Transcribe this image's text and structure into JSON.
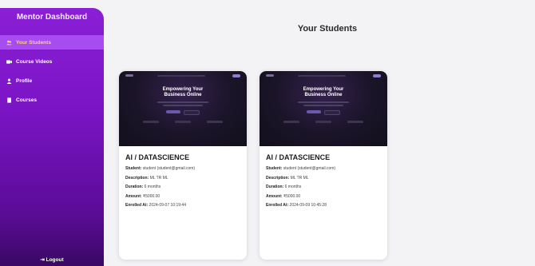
{
  "sidebar": {
    "title": "Mentor Dashboard",
    "items": [
      {
        "label": "Your Students",
        "icon": "users-icon",
        "active": true
      },
      {
        "label": "Course Videos",
        "icon": "video-icon",
        "active": false
      },
      {
        "label": "Profile",
        "icon": "person-icon",
        "active": false
      },
      {
        "label": "Courses",
        "icon": "book-icon",
        "active": false
      }
    ],
    "logout_label": "Logout"
  },
  "main": {
    "title": "Your Students"
  },
  "cards": [
    {
      "thumb_heading_line1": "Empowering Your",
      "thumb_heading_line2": "Business Online",
      "course": "AI / DATASCIENCE",
      "student_label": "Student:",
      "student": "student (student@gmail.com)",
      "description_label": "Description:",
      "description": "ML TR ML",
      "duration_label": "Duration:",
      "duration": "6 months",
      "amount_label": "Amount:",
      "amount": "₹5000.00",
      "enrolled_label": "Enrolled At:",
      "enrolled": "2024-09-07 10:19:44"
    },
    {
      "thumb_heading_line1": "Empowering Your",
      "thumb_heading_line2": "Business Online",
      "course": "AI / DATASCIENCE",
      "student_label": "Student:",
      "student": "student (student@gmail.com)",
      "description_label": "Description:",
      "description": "ML TR ML",
      "duration_label": "Duration:",
      "duration": "6 months",
      "amount_label": "Amount:",
      "amount": "₹5000.00",
      "enrolled_label": "Enrolled At:",
      "enrolled": "2024-09-09 10:45:28"
    }
  ],
  "colors": {
    "sidebar_top": "#8a1fd6",
    "sidebar_bottom": "#3a0864",
    "active_item_bg": "#a64cf0",
    "active_item_text": "#ffd480"
  }
}
